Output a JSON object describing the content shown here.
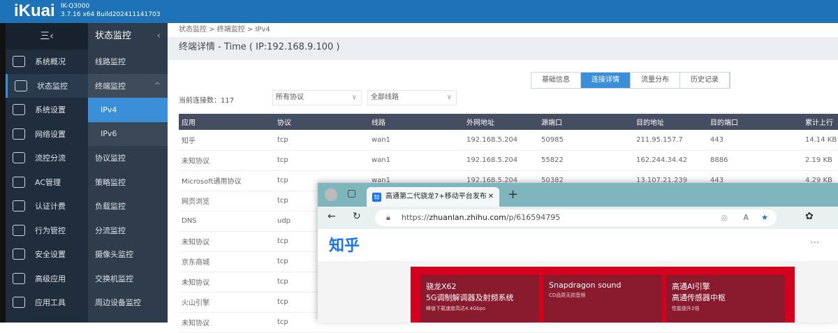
{
  "header": {
    "logo": "iKuai",
    "model": "IK-Q3000",
    "version": "3.7.16 x64 Build202411141703"
  },
  "sidebar": {
    "toggle": "三‹",
    "items": [
      {
        "label": "系统概况"
      },
      {
        "label": "状态监控"
      },
      {
        "label": "系统设置"
      },
      {
        "label": "网络设置"
      },
      {
        "label": "流控分流"
      },
      {
        "label": "AC管理"
      },
      {
        "label": "认证计费"
      },
      {
        "label": "行为管控"
      },
      {
        "label": "安全设置"
      },
      {
        "label": "高级应用"
      },
      {
        "label": "应用工具"
      }
    ]
  },
  "submenu": {
    "title": "状态监控",
    "items": [
      {
        "label": "线路监控"
      },
      {
        "label": "终端监控"
      },
      {
        "label": "IPv4"
      },
      {
        "label": "IPv6"
      },
      {
        "label": "协议监控"
      },
      {
        "label": "策略监控"
      },
      {
        "label": "负载监控"
      },
      {
        "label": "分流监控"
      },
      {
        "label": "摄像头监控"
      },
      {
        "label": "交换机监控"
      },
      {
        "label": "周边设备监控"
      }
    ]
  },
  "main": {
    "breadcrumb": "状态监控 > 终端监控 > IPv4",
    "title": "终端详情 - Time ( IP:192.168.9.100 )",
    "tabs": [
      {
        "label": "基础信息"
      },
      {
        "label": "连接详情"
      },
      {
        "label": "流量分布"
      },
      {
        "label": "历史记录"
      }
    ],
    "connections": "当前连接数：117",
    "protocol_filter": "所有协议",
    "line_filter": "全部线路",
    "columns": [
      "应用",
      "协议",
      "线路",
      "外网地址",
      "源端口",
      "目的地址",
      "目的端口",
      "累计上行"
    ],
    "rows": [
      [
        "知乎",
        "tcp",
        "wan1",
        "192.168.5.204",
        "50985",
        "211.95.157.7",
        "443",
        "14.14 KB"
      ],
      [
        "未知协议",
        "tcp",
        "wan1",
        "192.168.5.204",
        "55822",
        "162.244.34.42",
        "8886",
        "2.19 KB"
      ],
      [
        "Microsoft通用协议",
        "tcp",
        "wan1",
        "192.168.5.204",
        "50382",
        "13.107.21.239",
        "443",
        "4.29 KB"
      ],
      [
        "网页浏览",
        "tcp",
        "",
        "",
        "",
        "",
        "",
        ""
      ],
      [
        "DNS",
        "udp",
        "",
        "",
        "",
        "",
        "",
        ""
      ],
      [
        "未知协议",
        "tcp",
        "",
        "",
        "",
        "",
        "",
        ""
      ],
      [
        "京东商城",
        "tcp",
        "",
        "",
        "",
        "",
        "",
        ""
      ],
      [
        "未知协议",
        "tcp",
        "",
        "",
        "",
        "",
        "",
        ""
      ],
      [
        "火山引擎",
        "tcp",
        "",
        "",
        "",
        "",
        "",
        ""
      ],
      [
        "未知协议",
        "tcp",
        "",
        "",
        "",
        "",
        "",
        ""
      ]
    ]
  },
  "browser": {
    "tab_title": "高通第二代骁龙7+移动平台发布",
    "tab_favicon": "知",
    "url_prefix": "https://",
    "url_host": "zhuanlan.zhihu.com",
    "url_path": "/p/616594795",
    "site_logo": "知乎",
    "more": "···",
    "banner": [
      {
        "title": "骁龙X62",
        "line2": "5G调制解调器及射频系统",
        "small": "峰值下载速度高达4.4Gbps"
      },
      {
        "title": "Snapdragon sound",
        "line2": "",
        "small": "CD品质无损音频"
      },
      {
        "title": "高通AI引擎",
        "line2": "高通传感器中枢",
        "small": "性能提升2倍"
      }
    ]
  }
}
